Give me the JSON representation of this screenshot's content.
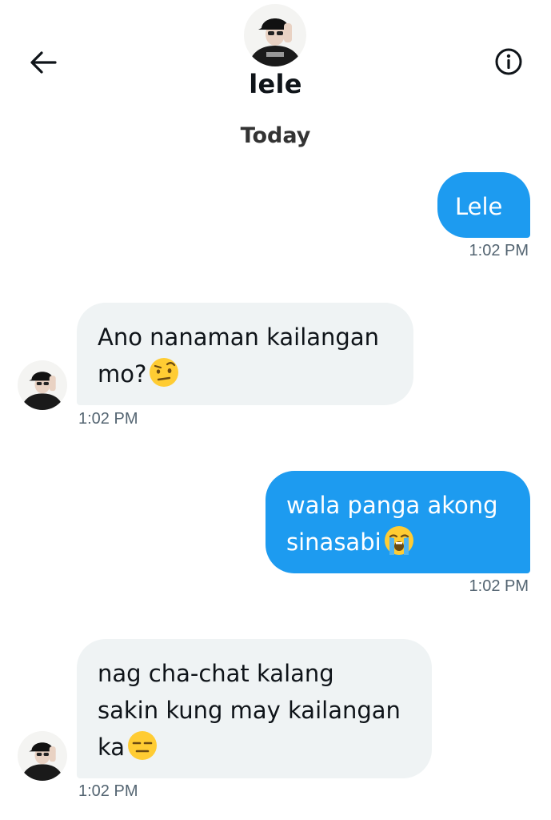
{
  "header": {
    "name": "lele",
    "back_icon": "arrow-left-icon",
    "info_icon": "info-circle-icon"
  },
  "date_separator": "Today",
  "messages": [
    {
      "direction": "sent",
      "lines": [
        "Lele"
      ],
      "emoji": "",
      "time": "1:02 PM"
    },
    {
      "direction": "received",
      "lines": [
        "Ano nanaman kailangan",
        "mo?"
      ],
      "emoji": "face-with-raised-eyebrow",
      "time": "1:02 PM"
    },
    {
      "direction": "sent",
      "lines": [
        "wala panga akong",
        "sinasabi"
      ],
      "emoji": "loudly-crying-face",
      "time": "1:02 PM"
    },
    {
      "direction": "received",
      "lines": [
        "nag cha-chat kalang",
        "sakin kung may kailangan",
        "ka"
      ],
      "emoji": "expressionless-face",
      "time": "1:02 PM"
    }
  ],
  "colors": {
    "sent_bubble": "#1d9bf0",
    "received_bubble": "#eff3f4",
    "timestamp": "#536471"
  }
}
